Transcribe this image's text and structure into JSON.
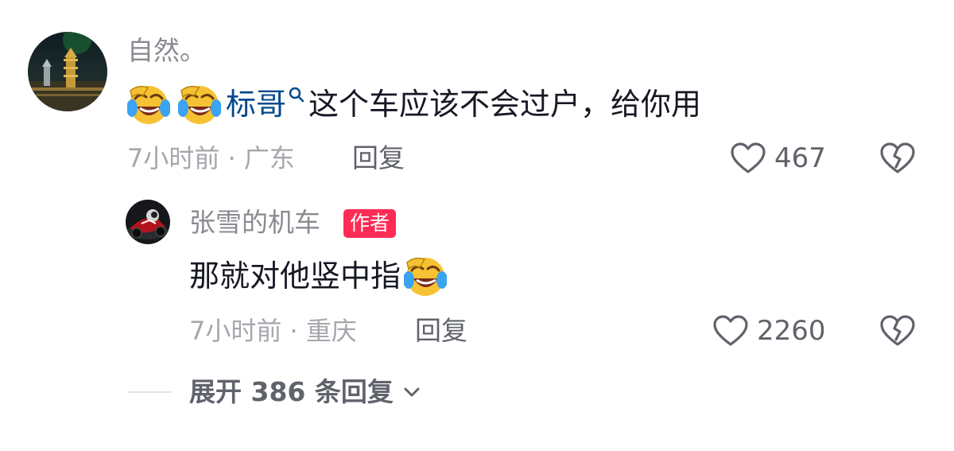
{
  "comment": {
    "username": "自然。",
    "text_mention": "标哥",
    "text_after": "这个车应该不会过户，给你用",
    "emojis": [
      "laughing-crying-emoji",
      "laughing-crying-emoji"
    ],
    "time_location": "7小时前 · 广东",
    "reply_label": "回复",
    "like_count": "467"
  },
  "reply": {
    "username": "张雪的机车",
    "badge": "作者",
    "text": "那就对他竖中指",
    "emojis": [
      "laughing-crying-emoji"
    ],
    "time_location": "7小时前 · 重庆",
    "reply_label": "回复",
    "like_count": "2260"
  },
  "expand": {
    "label": "展开 386 条回复"
  },
  "colors": {
    "badge": "#fe2c55",
    "mention": "#04498d",
    "secondary_text": "#8a8b91",
    "meta_text": "#a6a7ad"
  }
}
